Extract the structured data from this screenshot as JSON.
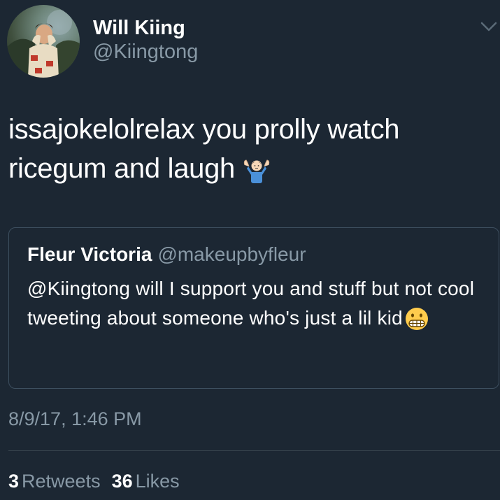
{
  "author": {
    "display_name": "Will Kiing",
    "handle": "@Kiingtong",
    "avatar_icon": "profile-photo"
  },
  "tweet": {
    "text": "issajokelolrelax you prolly watch ricegum and laugh",
    "emoji": "person-shrugging-emoji"
  },
  "quoted_tweet": {
    "display_name": "Fleur Victoria",
    "handle": "@makeupbyfleur",
    "text": "@Kiingtong will I support you and stuff but not cool tweeting about someone who's just a lil kid",
    "emoji": "grimacing-face-emoji"
  },
  "timestamp": "8/9/17, 1:46 PM",
  "stats": {
    "retweets_count": "3",
    "retweets_label": "Retweets",
    "likes_count": "36",
    "likes_label": "Likes"
  },
  "colors": {
    "background": "#1c2733",
    "primary_text": "#ffffff",
    "secondary_text": "#8899a6",
    "border": "#3d4f5f"
  },
  "icons": {
    "menu": "chevron-down-icon"
  }
}
